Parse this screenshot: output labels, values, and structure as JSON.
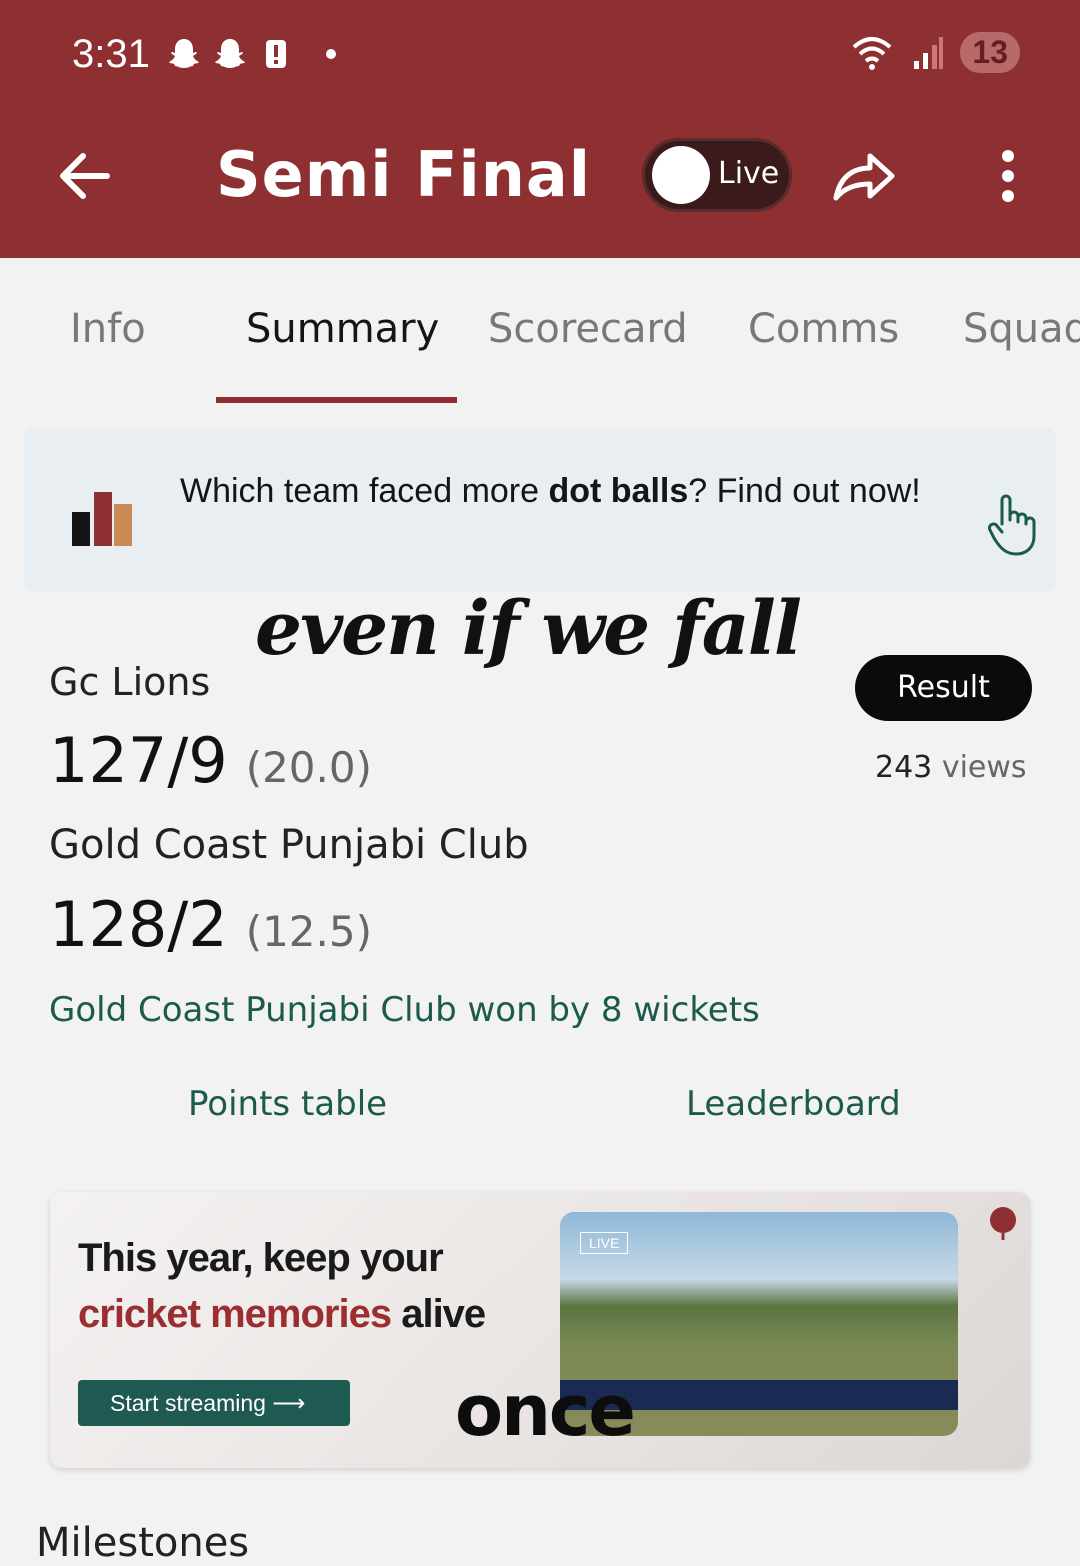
{
  "status": {
    "time": "3:31",
    "battery": "13"
  },
  "header": {
    "title": "Semi Final",
    "live_label": "Live"
  },
  "tabs": [
    {
      "label": "Info"
    },
    {
      "label": "Summary"
    },
    {
      "label": "Scorecard"
    },
    {
      "label": "Comms"
    },
    {
      "label": "Squad"
    }
  ],
  "promo": {
    "pre": "Which team faced more ",
    "bold": "dot balls",
    "post": "? Find out now!"
  },
  "overlay_text": {
    "top": "even if we fall",
    "bottom": "once"
  },
  "match": {
    "team1": {
      "name": "Gc Lions",
      "score": "127/9",
      "overs": "(20.0)"
    },
    "team2": {
      "name": "Gold Coast Punjabi Club",
      "score": "128/2",
      "overs": "(12.5)"
    },
    "result_button": "Result",
    "views_count": "243",
    "views_label": "views",
    "result_text": "Gold Coast Punjabi Club won by 8 wickets"
  },
  "links": {
    "points_table": "Points table",
    "leaderboard": "Leaderboard"
  },
  "ad": {
    "line1": "This year, keep your",
    "line2_accent": "cricket memories",
    "line2_rest": " alive",
    "button": "Start streaming",
    "live_badge": "LIVE"
  },
  "section": {
    "milestones": "Milestones"
  },
  "colors": {
    "brand": "#8e2f31",
    "link": "#1c5a4b",
    "ad_button": "#1f5a52"
  }
}
